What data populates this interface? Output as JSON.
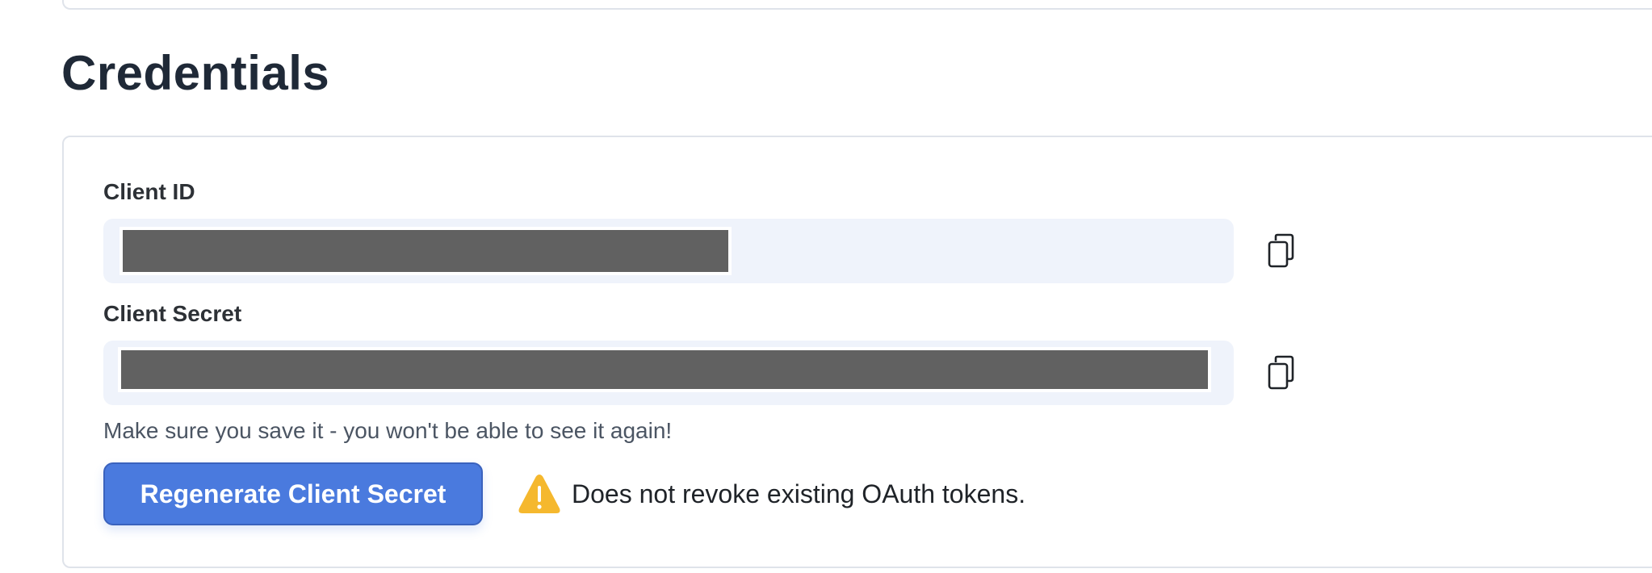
{
  "section": {
    "title": "Credentials"
  },
  "client_id": {
    "label": "Client ID",
    "value_redacted": true
  },
  "client_secret": {
    "label": "Client Secret",
    "value_redacted": true
  },
  "hint": "Make sure you save it - you won't be able to see it again!",
  "regenerate_button": {
    "label": "Regenerate Client Secret"
  },
  "warning": {
    "text": "Does not revoke existing OAuth tokens.",
    "icon": "warning-triangle-icon",
    "color": "#f5b82e"
  },
  "colors": {
    "accent": "#4a7ade",
    "field_bg": "#eff3fb",
    "redaction": "#616161"
  }
}
